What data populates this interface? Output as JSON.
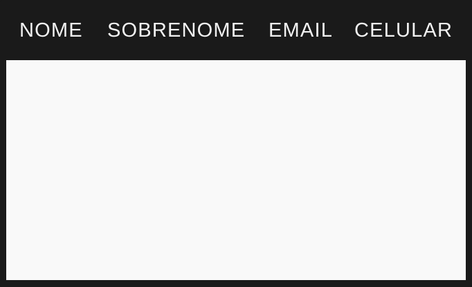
{
  "table": {
    "columns": [
      "NOME",
      "SOBRENOME",
      "EMAIL",
      "CELULAR"
    ],
    "rows": []
  },
  "colors": {
    "header_bg": "#1a1a1a",
    "header_text": "#f2f2f2",
    "body_bg": "#f9f9f9"
  }
}
